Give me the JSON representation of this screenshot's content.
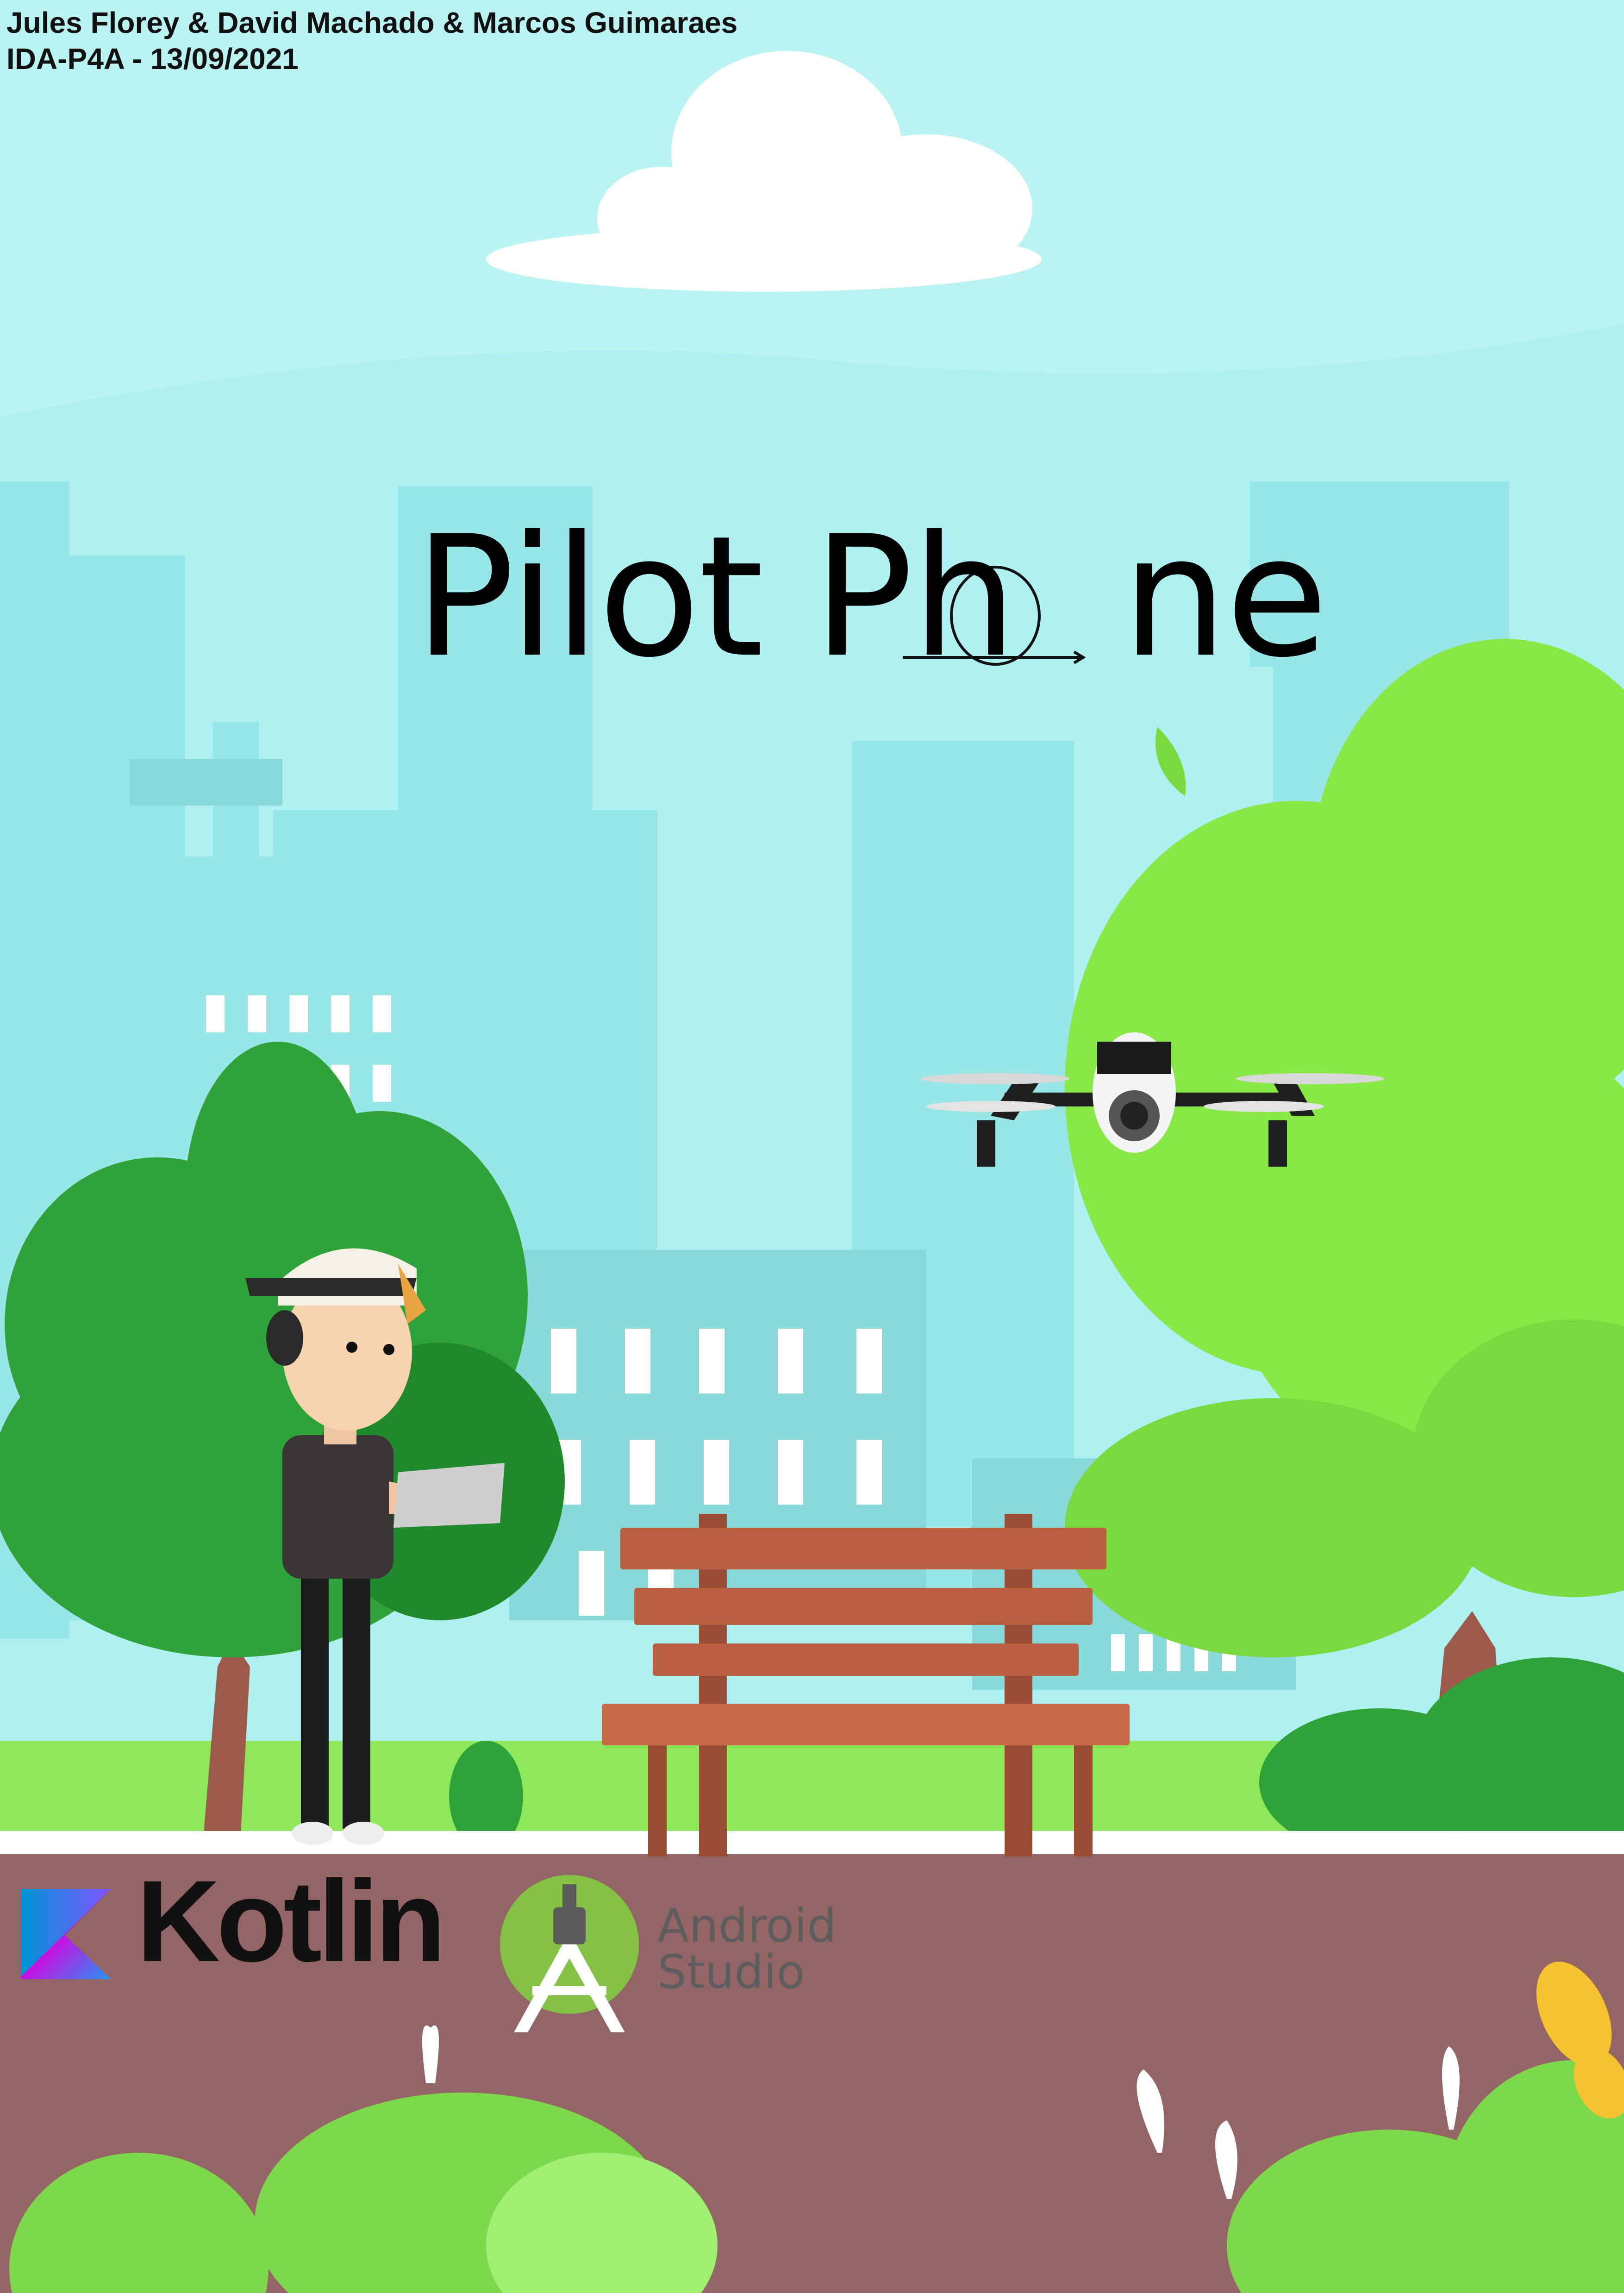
{
  "header": {
    "authors_line": "Jules Florey & David Machado & Marcos Guimaraes",
    "course_date_line": "IDA-P4A - 13/09/2021"
  },
  "title": {
    "part1": "Pilot Ph",
    "part2": "ne"
  },
  "logos": {
    "kotlin_text": "Kotlin",
    "android_studio_line1": "Android",
    "android_studio_line2": "Studio"
  },
  "colors": {
    "sky": "#aef1f0",
    "ground": "#946565",
    "grass": "#8fe85a",
    "tree_dark": "#2f9e35",
    "tree_light": "#88e846",
    "bench": "#b8603f"
  }
}
